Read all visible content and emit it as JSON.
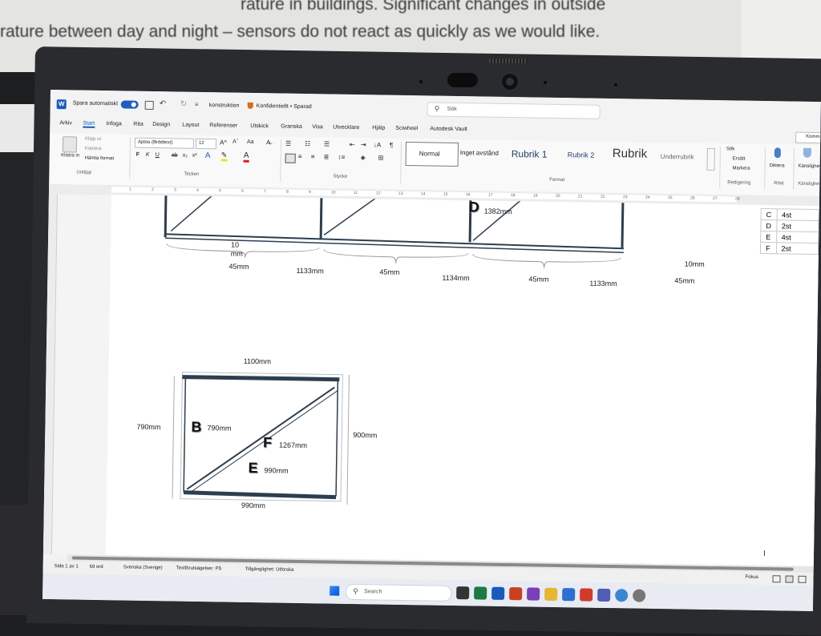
{
  "background": {
    "line1": "rature in buildings. Significant changes in outside",
    "line1_prefix": "rature between day and night – sensors do not react as quickly as we would like."
  },
  "titlebar": {
    "autosave_label": "Spara automatiskt",
    "doc_name": "konstruktion",
    "sensitivity": "Konfidentiellt • Sparad",
    "search_placeholder": "Sök"
  },
  "tabs": [
    "Arkiv",
    "Start",
    "Infoga",
    "Rita",
    "Design",
    "Layout",
    "Referenser",
    "Utskick",
    "Granska",
    "Visa",
    "Utvecklare",
    "Hjälp",
    "Sciwheel",
    "Autodesk Vault"
  ],
  "active_tab": "Start",
  "ribbon": {
    "clipboard": {
      "paste": "Klistra in",
      "cut": "Klipp ut",
      "copy": "Kopiera",
      "format_painter": "Hämta format",
      "group": "Urklipp"
    },
    "font": {
      "name": "Aptos (Brödtext)",
      "size": "12",
      "group": "Tecken"
    },
    "paragraph": {
      "group": "Stycke"
    },
    "styles": {
      "items": [
        "Normal",
        "Inget avstånd",
        "Rubrik 1",
        "Rubrik 2",
        "Rubrik",
        "Underrubrik"
      ],
      "group": "Format"
    },
    "editing": {
      "search": "Sök",
      "replace": "Ersätt",
      "select": "Markera",
      "group": "Redigering"
    },
    "voice": {
      "dictate": "Diktera",
      "group": "Röst"
    },
    "sensitivity": {
      "label": "Känslighet",
      "group": "Känslighet"
    },
    "comments": "Komm"
  },
  "ruler_numbers": [
    "1",
    "2",
    "3",
    "4",
    "5",
    "6",
    "7",
    "8",
    "9",
    "10",
    "11",
    "12",
    "13",
    "14",
    "15",
    "16",
    "17",
    "18",
    "19",
    "20",
    "21",
    "22",
    "23",
    "24",
    "25",
    "26",
    "27",
    "28"
  ],
  "drawing": {
    "top": {
      "label_d": "D",
      "d_value": "1382mm",
      "left_gap": "10",
      "left_gap_unit": "mm",
      "right_gap": "10mm",
      "posts": [
        "45mm",
        "45mm",
        "45mm",
        "45mm"
      ],
      "spans": [
        "1133mm",
        "1134mm",
        "1133mm"
      ]
    },
    "frame": {
      "top_width": "1100mm",
      "bottom_width": "990mm",
      "left_height": "790mm",
      "right_height": "900mm",
      "label_b": "B",
      "b_value": "790mm",
      "label_f": "F",
      "f_value": "1267mm",
      "label_e": "E",
      "e_value": "990mm"
    },
    "table": {
      "rows": [
        [
          "C",
          "4st"
        ],
        [
          "D",
          "2st"
        ],
        [
          "E",
          "4st"
        ],
        [
          "F",
          "2st"
        ]
      ]
    }
  },
  "status": {
    "page": "Sida 1 av 1",
    "words": "69 ord",
    "language": "Svenska (Sverige)",
    "predictions": "Textförutsägelser: På",
    "accessibility": "Tillgänglighet: Utforska",
    "focus": "Fokus"
  },
  "taskbar": {
    "search": "Search"
  },
  "colors": {
    "frame_stroke": "#2d3e4f",
    "word_blue": "#185abd",
    "autosave_toggle": "#1f5fbf"
  }
}
